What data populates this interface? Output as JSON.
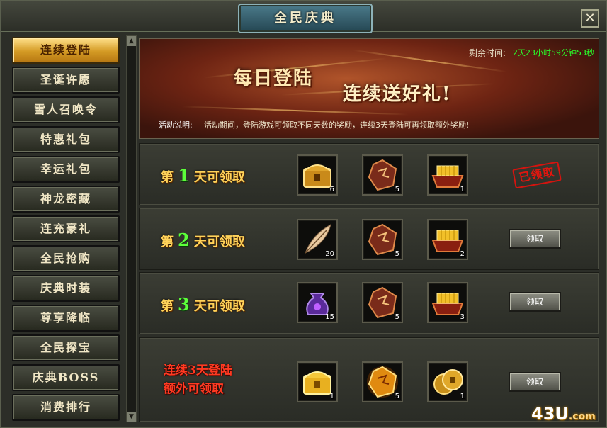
{
  "window": {
    "title": "全民庆典",
    "close_symbol": "✕"
  },
  "sidebar": {
    "items": [
      {
        "label": "连续登陆",
        "active": true
      },
      {
        "label": "圣诞许愿"
      },
      {
        "label": "雪人召唤令"
      },
      {
        "label": "特惠礼包"
      },
      {
        "label": "幸运礼包"
      },
      {
        "label": "神龙密藏"
      },
      {
        "label": "连充豪礼"
      },
      {
        "label": "全民抢购"
      },
      {
        "label": "庆典时装"
      },
      {
        "label": "尊享降临"
      },
      {
        "label": "全民探宝"
      },
      {
        "label": "庆典BOSS"
      },
      {
        "label": "消费排行"
      }
    ]
  },
  "banner": {
    "remaining_label": "剩余时间:",
    "remaining_value": "2天23小时59分钟53秒",
    "headline_1": "每日登陆",
    "headline_2": "连续送好礼!",
    "desc_label": "活动说明:",
    "desc_text": "活动期间，登陆游戏可领取不同天数的奖励，连续3天登陆可再领取额外奖励!"
  },
  "rows": [
    {
      "prefix": "第",
      "day": "1",
      "suffix": "天可领取",
      "items": [
        {
          "icon": "treasure-chest-icon",
          "count": "6"
        },
        {
          "icon": "rune-stone-icon",
          "count": "5"
        },
        {
          "icon": "gold-ingot-box-icon",
          "count": "1"
        }
      ],
      "status": "已领取"
    },
    {
      "prefix": "第",
      "day": "2",
      "suffix": "天可领取",
      "items": [
        {
          "icon": "feather-icon",
          "count": "20"
        },
        {
          "icon": "rune-stone-icon",
          "count": "5"
        },
        {
          "icon": "gold-ingot-box-icon",
          "count": "2"
        }
      ],
      "button": "领取"
    },
    {
      "prefix": "第",
      "day": "3",
      "suffix": "天可领取",
      "items": [
        {
          "icon": "purple-pouch-icon",
          "count": "15"
        },
        {
          "icon": "rune-stone-icon",
          "count": "5"
        },
        {
          "icon": "gold-ingot-box-icon",
          "count": "3"
        }
      ],
      "button": "领取"
    }
  ],
  "bonus": {
    "line1": "连续3天登陆",
    "line2": "额外可领取",
    "items": [
      {
        "icon": "golden-chest-icon",
        "count": "1"
      },
      {
        "icon": "glowing-rune-stone-icon",
        "count": "5"
      },
      {
        "icon": "copper-coin-icon",
        "count": "1"
      }
    ],
    "button": "领取"
  },
  "watermark": {
    "brand": "43U",
    "suffix": ".com"
  },
  "colors": {
    "accent_gold": "#d49a24",
    "timer_green": "#2aff2a",
    "day_number_green": "#5cff3a",
    "claimed_red": "#e3150e"
  }
}
